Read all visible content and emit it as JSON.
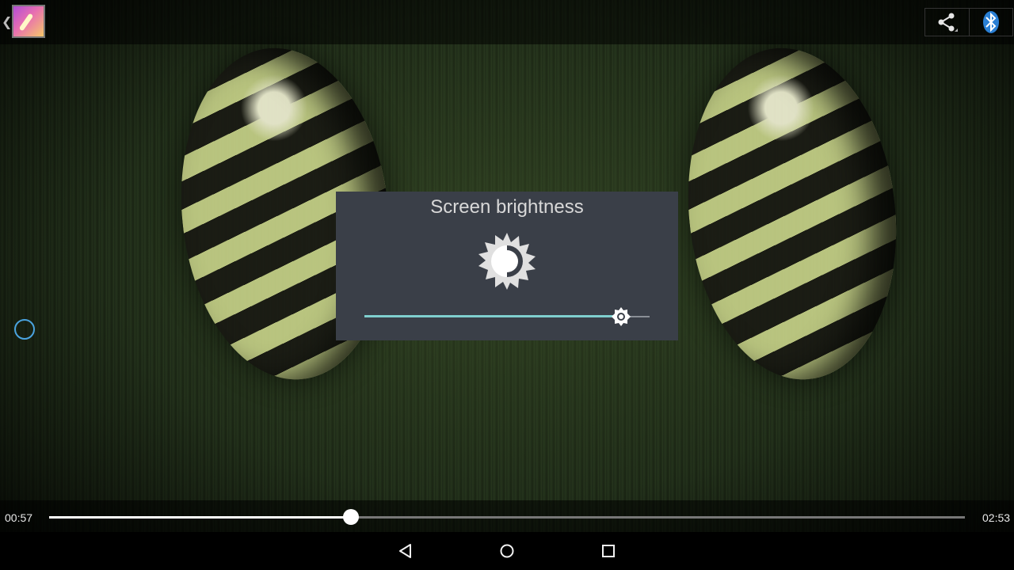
{
  "top_bar": {
    "app_icon": "gallery-app-icon",
    "back_icon": "chevron-left-icon",
    "actions": [
      {
        "name": "share",
        "icon": "share-icon"
      },
      {
        "name": "bluetooth",
        "icon": "bluetooth-icon"
      }
    ]
  },
  "brightness_dialog": {
    "title": "Screen brightness",
    "icon": "brightness-icon",
    "level": 0.9,
    "accent_color": "#7fcfcf"
  },
  "playback": {
    "current_time": "00:57",
    "total_time": "02:53",
    "progress": 0.33
  },
  "nav_bar": {
    "back_icon": "back-triangle-icon",
    "home_icon": "home-circle-icon",
    "recents_icon": "recents-square-icon"
  }
}
